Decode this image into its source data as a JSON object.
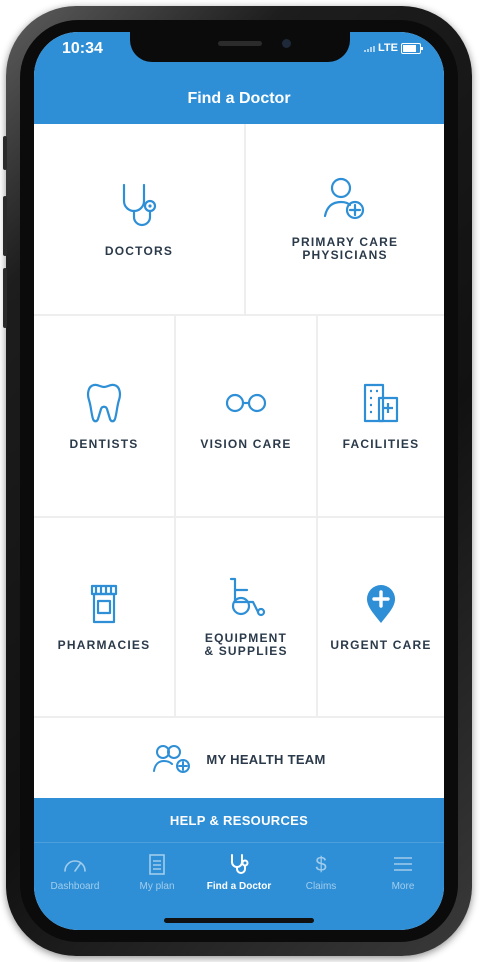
{
  "status_bar": {
    "time": "10:34",
    "network": "LTE"
  },
  "header": {
    "title": "Find a Doctor"
  },
  "tiles": {
    "doctors": {
      "label": "DOCTORS",
      "icon": "stethoscope-icon"
    },
    "primary_care": {
      "label": "PRIMARY CARE\nPHYSICIANS",
      "icon": "user-plus-icon"
    },
    "dentists": {
      "label": "DENTISTS",
      "icon": "tooth-icon"
    },
    "vision_care": {
      "label": "VISION CARE",
      "icon": "glasses-icon"
    },
    "facilities": {
      "label": "FACILITIES",
      "icon": "hospital-building-icon"
    },
    "pharmacies": {
      "label": "PHARMACIES",
      "icon": "pill-bottle-icon"
    },
    "equipment": {
      "label": "EQUIPMENT\n& SUPPLIES",
      "icon": "wheelchair-icon"
    },
    "urgent_care": {
      "label": "URGENT CARE",
      "icon": "medical-pin-icon"
    },
    "health_team": {
      "label": "MY HEALTH TEAM",
      "icon": "team-plus-icon"
    }
  },
  "help_bar": {
    "label": "HELP & RESOURCES"
  },
  "tabs": [
    {
      "label": "Dashboard",
      "icon": "gauge-icon",
      "active": false
    },
    {
      "label": "My plan",
      "icon": "clipboard-icon",
      "active": false
    },
    {
      "label": "Find a Doctor",
      "icon": "stethoscope-icon",
      "active": true
    },
    {
      "label": "Claims",
      "icon": "dollar-icon",
      "active": false
    },
    {
      "label": "More",
      "icon": "menu-icon",
      "active": false
    }
  ],
  "colors": {
    "primary": "#2e8fd6",
    "tile_text": "#2b3a4a",
    "icon": "#2e8fd6"
  }
}
